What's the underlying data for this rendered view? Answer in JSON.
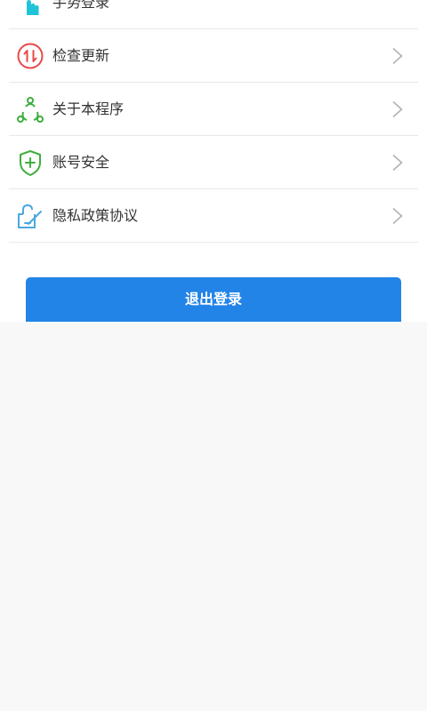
{
  "settings": {
    "items": [
      {
        "label": "手势登录",
        "icon": "gesture-hand-icon",
        "control": "toggle",
        "toggle_on": false
      },
      {
        "label": "检查更新",
        "icon": "update-arrows-icon",
        "control": "chevron"
      },
      {
        "label": "关于本程序",
        "icon": "about-nodes-icon",
        "control": "chevron"
      },
      {
        "label": "账号安全",
        "icon": "shield-plus-icon",
        "control": "chevron"
      },
      {
        "label": "隐私政策协议",
        "icon": "privacy-edit-icon",
        "control": "chevron"
      }
    ]
  },
  "logout": {
    "label": "退出登录"
  },
  "colors": {
    "accent": "#2384e8",
    "gesture_icon": "#1fc4d8",
    "update_icon": "#e8494a",
    "about_icon": "#3fae3f",
    "shield_icon": "#3fae3f",
    "privacy_icon": "#4aa8e0",
    "background": "#f8f8f8"
  }
}
